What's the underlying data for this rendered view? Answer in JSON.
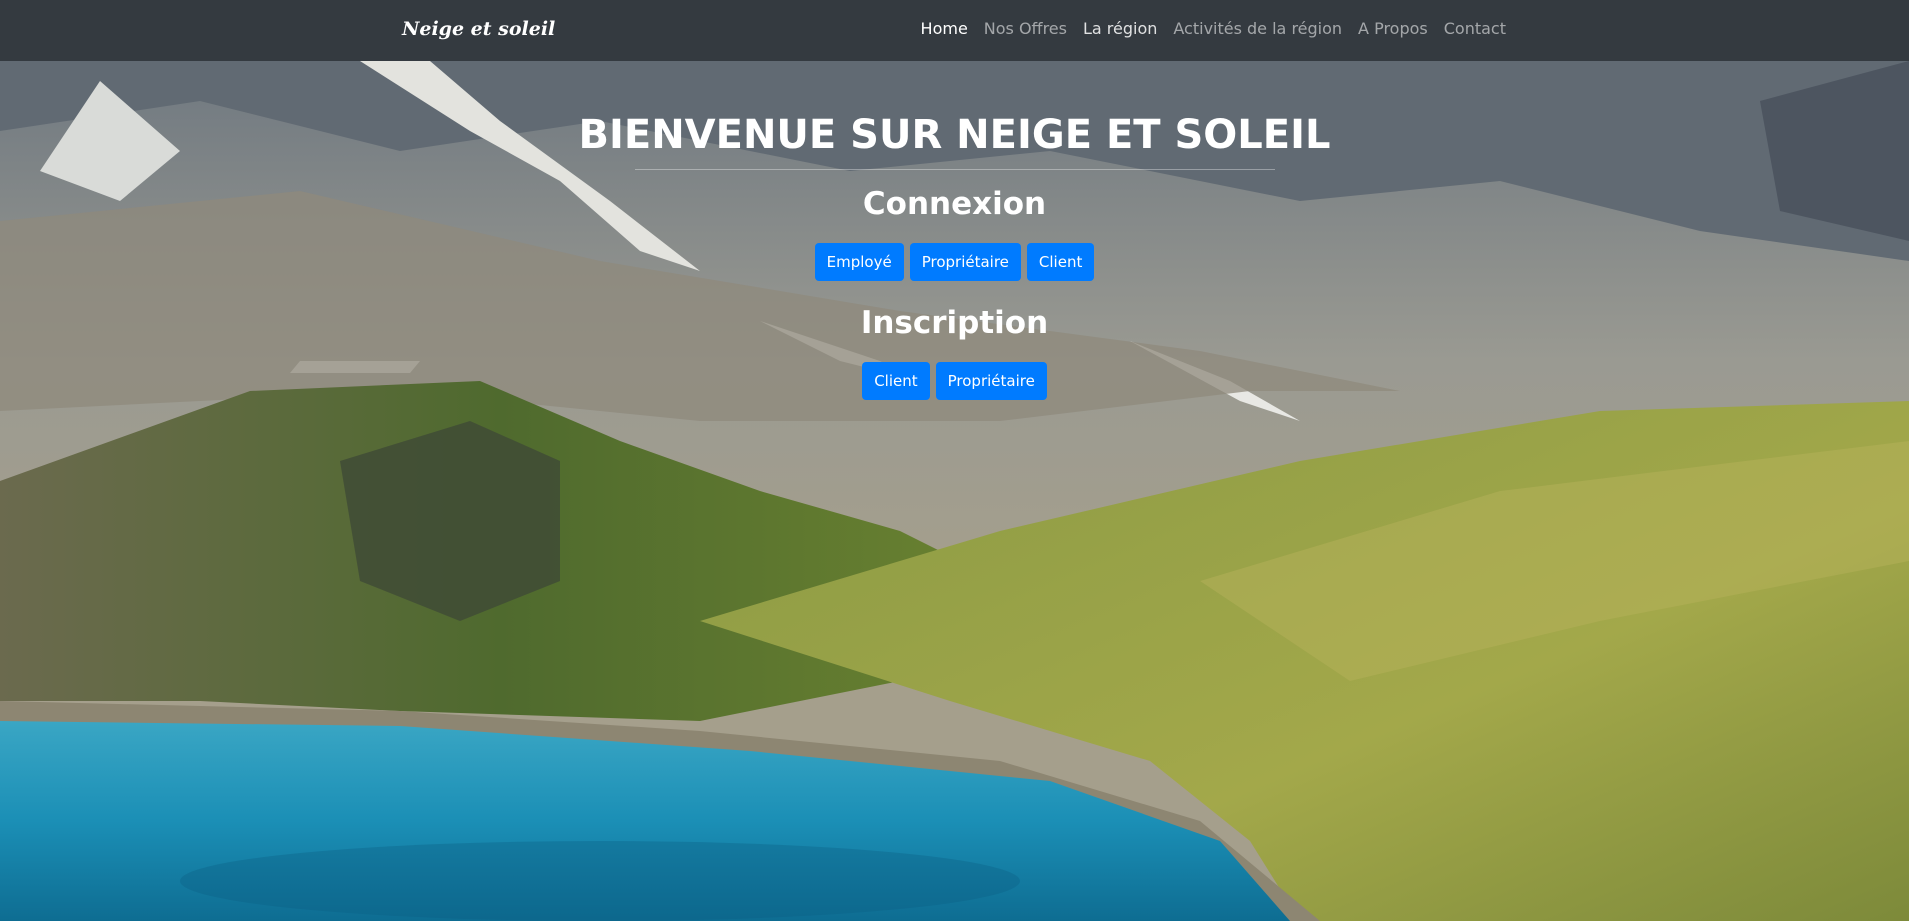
{
  "navbar": {
    "brand": "Neige et soleil",
    "links": [
      {
        "label": "Home"
      },
      {
        "label": "Nos Offres"
      },
      {
        "label": "La région"
      },
      {
        "label": "Activités de la région"
      },
      {
        "label": "A Propos"
      },
      {
        "label": "Contact"
      }
    ]
  },
  "hero": {
    "title": "BIENVENUE SUR NEIGE ET SOLEIL",
    "connexion": {
      "heading": "Connexion",
      "buttons": [
        {
          "label": "Employé"
        },
        {
          "label": "Propriétaire"
        },
        {
          "label": "Client"
        }
      ]
    },
    "inscription": {
      "heading": "Inscription",
      "buttons": [
        {
          "label": "Client"
        },
        {
          "label": "Propriétaire"
        }
      ]
    }
  },
  "colors": {
    "navbar_bg": "#343a40",
    "button_primary": "#007bff",
    "lake": "#1a9fc4",
    "grass": "#8fa83a"
  }
}
